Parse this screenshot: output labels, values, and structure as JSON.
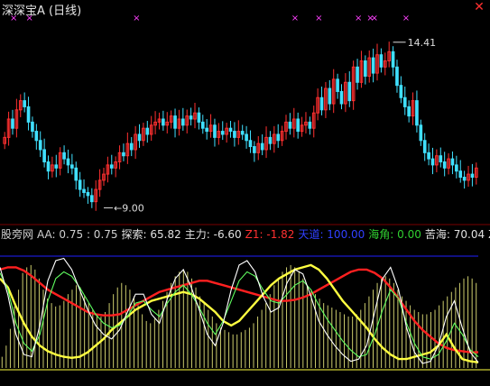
{
  "window": {
    "title": "深深宝A (日线)"
  },
  "price_labels": {
    "high": "14.41",
    "low": "9.00"
  },
  "indicator_bar": [
    {
      "label": "股旁网",
      "color": "#d0d0d0"
    },
    {
      "label": "AA: 0.75 : 0.75",
      "color": "#d0d0d0"
    },
    {
      "label": "探索: 65.82",
      "color": "#e0e0e0"
    },
    {
      "label": "主力: -6.60",
      "color": "#e0e0e0"
    },
    {
      "label": "Z1: -1.82",
      "color": "#ff3030"
    },
    {
      "label": "天道: 100.00",
      "color": "#3040ff"
    },
    {
      "label": "海角: 0.00",
      "color": "#30d030"
    },
    {
      "label": "苦海: 70.04",
      "color": "#e0e0e0"
    },
    {
      "label": "Z",
      "color": "#e0e0e0"
    }
  ],
  "colors": {
    "up": "#ff3030",
    "down": "#40e0ff",
    "marker": "#ff40ff",
    "blue_line": "#2020ff",
    "red_line": "#ff2020",
    "yellow_line": "#ffff40",
    "green_line": "#60ff60",
    "white_line": "#ffffff",
    "hist": "#f0f080"
  },
  "chart_data": [
    {
      "type": "candlestick",
      "title": "",
      "ylim": [
        8.6,
        15.2
      ],
      "annotations": [
        {
          "text": "14.41",
          "x": 98,
          "y": 14.41
        },
        {
          "text": "9.00",
          "x": 25,
          "y": 9.0
        }
      ],
      "markers_x": [
        2,
        6,
        33,
        73,
        79,
        89,
        92,
        93,
        101
      ],
      "closes": [
        11.3,
        11.9,
        11.6,
        12.2,
        12.5,
        12.3,
        11.8,
        11.5,
        11.2,
        10.9,
        10.5,
        10.2,
        10.4,
        10.3,
        10.8,
        10.6,
        10.4,
        10.3,
        9.9,
        9.6,
        9.5,
        9.4,
        9.2,
        9.6,
        9.9,
        10.1,
        10.4,
        10.3,
        10.5,
        10.8,
        10.7,
        11.1,
        10.9,
        11.4,
        11.2,
        11.6,
        11.4,
        11.7,
        11.8,
        11.9,
        11.7,
        11.8,
        12.0,
        11.6,
        11.9,
        11.7,
        12.0,
        11.9,
        12.1,
        11.8,
        11.6,
        11.5,
        11.7,
        11.3,
        11.5,
        11.4,
        11.6,
        11.5,
        11.3,
        11.5,
        11.4,
        11.2,
        11.0,
        10.8,
        11.1,
        10.9,
        11.3,
        11.1,
        11.4,
        11.2,
        11.5,
        11.8,
        11.6,
        11.9,
        11.5,
        11.7,
        11.8,
        11.6,
        12.1,
        12.6,
        12.2,
        12.9,
        12.4,
        13.2,
        12.8,
        12.4,
        13.1,
        12.5,
        13.6,
        13.1,
        13.8,
        13.3,
        13.9,
        13.4,
        14.0,
        13.6,
        13.8,
        14.1,
        13.6,
        13.0,
        12.6,
        12.3,
        12.0,
        12.5,
        11.7,
        11.2,
        10.8,
        10.6,
        10.4,
        10.7,
        10.5,
        10.3,
        10.6,
        10.4,
        10.2,
        10.0,
        9.9,
        10.1,
        10.0,
        10.3
      ]
    },
    {
      "type": "line",
      "title": "",
      "ylim": [
        0,
        100
      ],
      "series": [
        {
          "name": "",
          "color_key": "blue_line",
          "values": [
            100,
            100
          ]
        },
        {
          "name": "",
          "color_key": "red_line",
          "values": [
            88,
            90,
            90,
            87,
            82,
            76,
            70,
            66,
            62,
            58,
            54,
            50,
            48,
            47,
            47,
            48,
            52,
            56,
            60,
            64,
            68,
            70,
            72,
            74,
            76,
            78,
            78,
            76,
            74,
            72,
            70,
            68,
            66,
            64,
            62,
            60,
            60,
            61,
            63,
            66,
            70,
            74,
            78,
            82,
            86,
            88,
            88,
            85,
            80,
            72,
            62,
            52,
            42,
            34,
            28,
            22,
            18,
            16,
            15,
            14,
            14
          ]
        },
        {
          "name": "",
          "color_key": "yellow_line",
          "values": [
            80,
            72,
            55,
            40,
            28,
            20,
            15,
            12,
            10,
            9,
            10,
            14,
            20,
            26,
            34,
            40,
            46,
            52,
            56,
            60,
            62,
            64,
            66,
            68,
            66,
            62,
            56,
            50,
            42,
            38,
            42,
            50,
            58,
            66,
            74,
            80,
            84,
            88,
            90,
            92,
            88,
            80,
            70,
            60,
            52,
            44,
            36,
            26,
            18,
            12,
            8,
            8,
            10,
            12,
            14,
            20,
            30,
            18,
            8,
            6,
            5
          ]
        },
        {
          "name": "",
          "color_key": "green_line",
          "values": [
            85,
            70,
            40,
            22,
            15,
            30,
            60,
            80,
            86,
            82,
            72,
            60,
            48,
            40,
            36,
            38,
            46,
            58,
            60,
            52,
            46,
            58,
            68,
            74,
            66,
            54,
            40,
            30,
            42,
            60,
            78,
            86,
            82,
            70,
            60,
            58,
            66,
            74,
            78,
            70,
            56,
            44,
            34,
            24,
            16,
            10,
            12,
            30,
            52,
            70,
            62,
            40,
            22,
            10,
            8,
            12,
            24,
            40,
            30,
            16,
            10
          ]
        },
        {
          "name": "",
          "color_key": "white_line",
          "values": [
            90,
            65,
            30,
            12,
            10,
            38,
            78,
            96,
            98,
            88,
            70,
            52,
            38,
            30,
            26,
            34,
            50,
            66,
            66,
            48,
            40,
            62,
            80,
            88,
            72,
            52,
            30,
            20,
            40,
            70,
            92,
            96,
            86,
            64,
            50,
            54,
            76,
            88,
            84,
            64,
            42,
            30,
            20,
            12,
            6,
            8,
            20,
            50,
            80,
            90,
            70,
            36,
            14,
            4,
            6,
            20,
            46,
            60,
            36,
            14,
            5
          ]
        }
      ],
      "histogram": [
        10,
        20,
        35,
        55,
        70,
        85,
        90,
        92,
        88,
        80,
        70,
        62,
        58,
        55,
        56,
        60,
        66,
        70,
        74,
        72,
        65,
        58,
        52,
        48,
        46,
        50,
        58,
        66,
        72,
        76,
        74,
        70,
        64,
        56,
        48,
        42,
        40,
        44,
        52,
        60,
        68,
        76,
        82,
        86,
        88,
        86,
        80,
        72,
        64,
        58,
        52,
        46,
        40,
        36,
        34,
        32,
        30,
        30,
        32,
        34,
        36,
        40,
        46,
        52,
        58,
        66,
        74,
        80,
        86,
        90,
        92,
        90,
        86,
        80,
        74,
        70,
        66,
        62,
        58,
        56,
        54,
        52,
        50,
        48,
        46,
        46,
        48,
        52,
        58,
        64,
        70,
        76,
        80,
        82,
        80,
        76,
        70,
        64,
        60,
        56,
        52,
        50,
        48,
        48,
        50,
        52,
        56,
        60,
        64,
        68,
        72,
        76,
        80,
        82,
        80,
        76
      ]
    }
  ]
}
